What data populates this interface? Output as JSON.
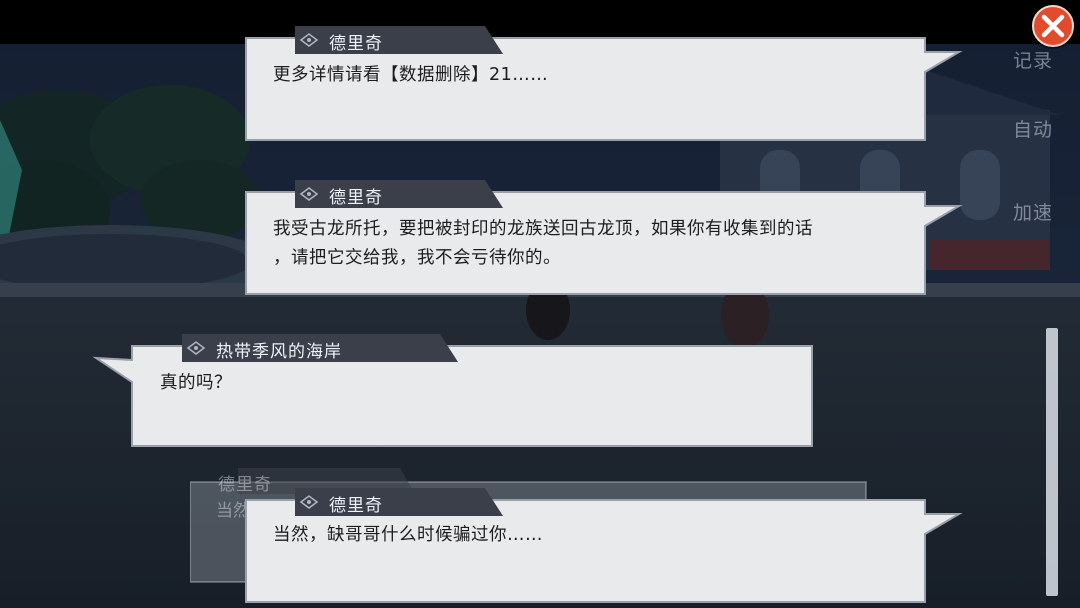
{
  "controls": {
    "close_icon": "close-icon",
    "log_label": "记录",
    "auto_label": "自动",
    "speed_label": "加速"
  },
  "dialogue": [
    {
      "speaker": "德里奇",
      "lines": [
        "更多详情请看【数据删除】21……"
      ]
    },
    {
      "speaker": "德里奇",
      "lines": [
        "我受古龙所托，要把被封印的龙族送回古龙顶，如果你有收集到的话",
        "，请把它交给我，我不会亏待你的。"
      ]
    },
    {
      "speaker": "热带季风的海岸",
      "lines": [
        "真的吗？"
      ]
    },
    {
      "speaker": "德里奇",
      "lines": [
        "当然，缺哥哥什么时候骗过你……"
      ]
    }
  ],
  "ghost_bubble": {
    "speaker": "德里奇",
    "text": "当然"
  },
  "colors": {
    "bubble_fill": "#e9eaec",
    "bubble_border": "#9aa0aa",
    "nametag_fill": "#3a3f49",
    "text": "#1d1d1d",
    "close_button": "#e24b2e"
  }
}
